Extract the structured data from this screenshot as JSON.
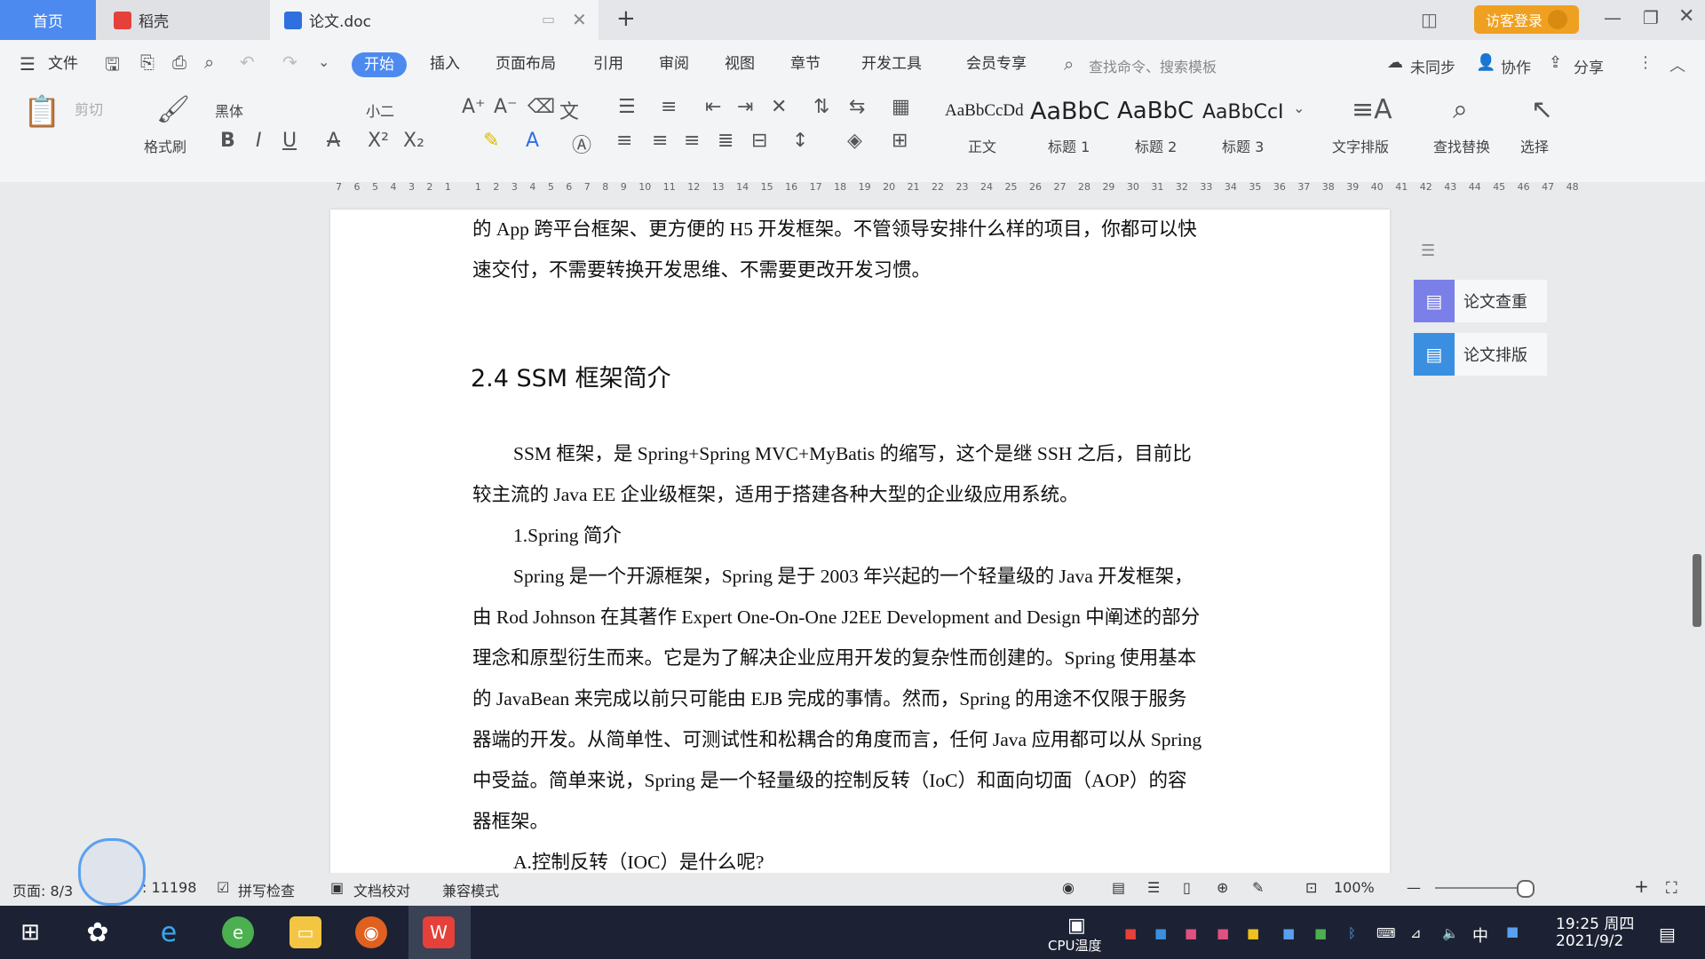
{
  "tabs": {
    "home": "首页",
    "daoke": "稻壳",
    "doc": "论文.doc",
    "new": "+"
  },
  "titlebar": {
    "login": "访客登录"
  },
  "menu": {
    "file": "文件",
    "items": [
      "开始",
      "插入",
      "页面布局",
      "引用",
      "审阅",
      "视图",
      "章节",
      "开发工具",
      "会员专享"
    ],
    "search": "查找命令、搜索模板",
    "sync": "未同步",
    "collab": "协作",
    "share": "分享"
  },
  "ribbon": {
    "cut": "剪切",
    "format_painter": "格式刷",
    "font": "黑体",
    "size": "小二",
    "styles": [
      {
        "preview": "AaBbCcDd",
        "name": "正文"
      },
      {
        "preview": "AaBbC",
        "name": "标题 1"
      },
      {
        "preview": "AaBbC",
        "name": "标题 2"
      },
      {
        "preview": "AaBbCcI",
        "name": "标题 3"
      }
    ],
    "text_layout": "文字排版",
    "find_replace": "查找替换",
    "select": "选择"
  },
  "ruler": [
    "7",
    "6",
    "5",
    "4",
    "3",
    "2",
    "1",
    "",
    "1",
    "2",
    "3",
    "4",
    "5",
    "6",
    "7",
    "8",
    "9",
    "10",
    "11",
    "12",
    "13",
    "14",
    "15",
    "16",
    "17",
    "18",
    "19",
    "20",
    "21",
    "22",
    "23",
    "24",
    "25",
    "26",
    "27",
    "28",
    "29",
    "30",
    "31",
    "32",
    "33",
    "34",
    "35",
    "36",
    "37",
    "38",
    "39",
    "40",
    "41",
    "42",
    "43",
    "44",
    "45",
    "46",
    "47",
    "48"
  ],
  "document": {
    "p1_line1": "的 App 跨平台框架、更方便的 H5 开发框架。不管领导安排什么样的项目，你都可以快",
    "p1_line2": "速交付，不需要转换开发思维、不需要更改开发习惯。",
    "heading": "2.4 SSM 框架简介",
    "p2_line1": "SSM 框架，是 Spring+Spring MVC+MyBatis 的缩写，这个是继 SSH 之后，目前比",
    "p2_line2": "较主流的 Java EE 企业级框架，适用于搭建各种大型的企业级应用系统。",
    "p3": "1.Spring 简介",
    "p4_line1": "Spring 是一个开源框架，Spring 是于 2003 年兴起的一个轻量级的 Java 开发框架，",
    "p4_line2": "由 Rod Johnson 在其著作 Expert One-On-One J2EE Development and Design 中阐述的部分",
    "p4_line3": "理念和原型衍生而来。它是为了解决企业应用开发的复杂性而创建的。Spring 使用基本",
    "p4_line4": "的 JavaBean 来完成以前只可能由 EJB 完成的事情。然而，Spring 的用途不仅限于服务",
    "p4_line5": "器端的开发。从简单性、可测试性和松耦合的角度而言，任何 Java 应用都可以从 Spring",
    "p4_line6": "中受益。简单来说，Spring 是一个轻量级的控制反转（IoC）和面向切面（AOP）的容",
    "p4_line7": "器框架。",
    "p5": "A.控制反转（IOC）是什么呢?"
  },
  "right_panel": {
    "check": "论文查重",
    "layout": "论文排版"
  },
  "status": {
    "page": "页面: 8/3",
    "words": ": 11198",
    "spell": "拼写检查",
    "proof": "文档校对",
    "compat": "兼容模式",
    "zoom": "100%"
  },
  "taskbar": {
    "cpu": "CPU温度",
    "ime": "中",
    "time": "19:25 周四",
    "date": "2021/9/2"
  },
  "colors": {
    "accent": "#4d8af0",
    "taskbar": "#1c2233",
    "login_badge": "#f0a020"
  }
}
